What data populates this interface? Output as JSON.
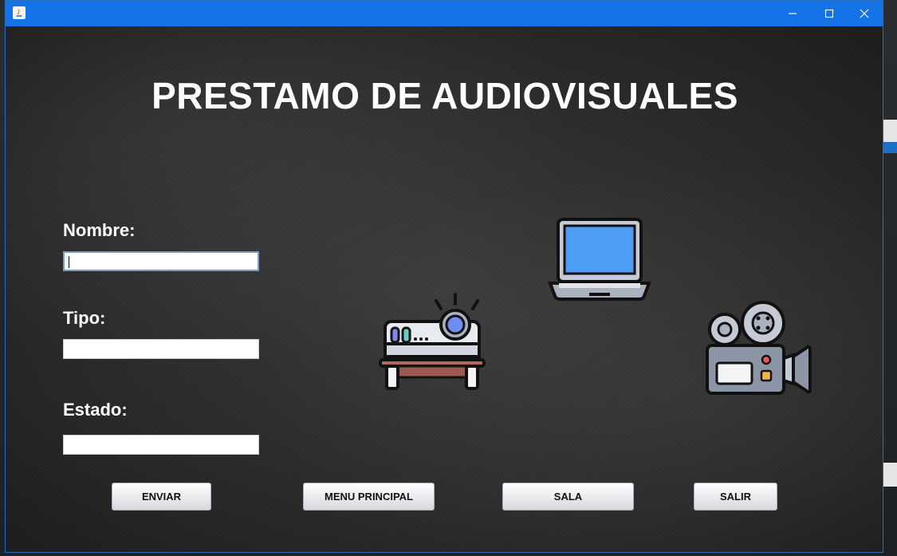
{
  "window": {
    "title": "",
    "controls": [
      "minimize-icon",
      "maximize-icon",
      "close-icon"
    ]
  },
  "heading": "PRESTAMO DE AUDIOVISUALES",
  "form": {
    "nombre_label": "Nombre:",
    "nombre_value": "",
    "tipo_label": "Tipo:",
    "tipo_value": "",
    "estado_label": "Estado:",
    "estado_value": ""
  },
  "buttons": {
    "enviar": "ENVIAR",
    "menu_principal": "MENU PRINCIPAL",
    "sala": "SALA",
    "salir": "SALIR"
  },
  "icons": [
    "projector-icon",
    "laptop-icon",
    "video-camera-icon"
  ],
  "colors": {
    "titlebar": "#1473e6",
    "background": "#2b2b2b",
    "heading": "#ffffff"
  }
}
